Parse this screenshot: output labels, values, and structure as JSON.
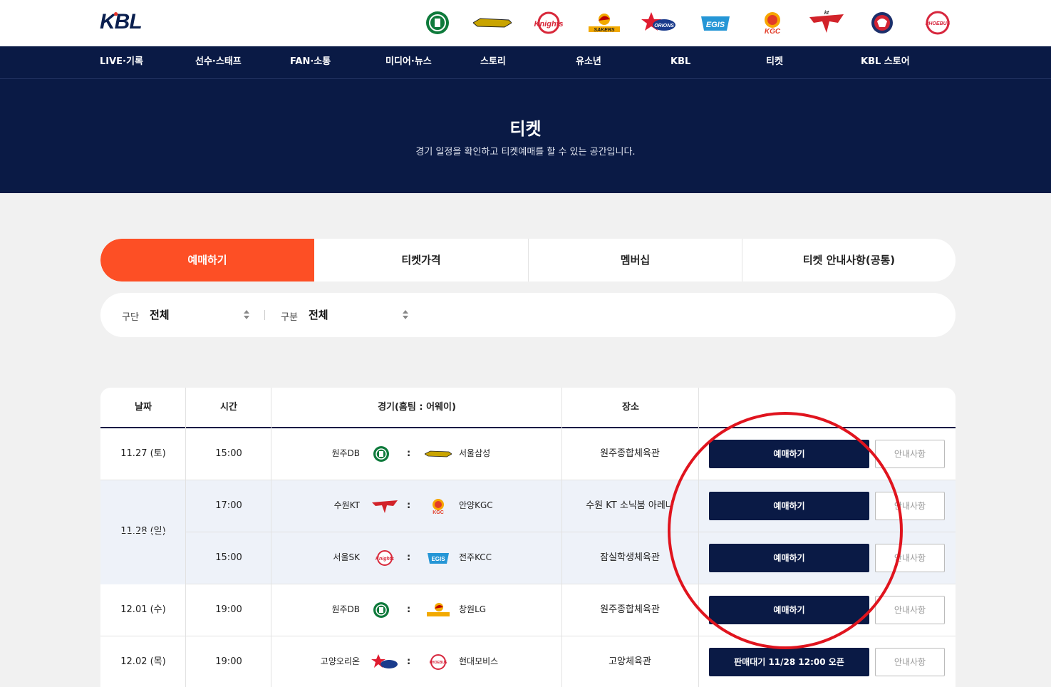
{
  "header": {
    "logo_text": "KBL",
    "team_logos": [
      {
        "name": "db-promy",
        "label": "DB",
        "color": "#0e7a3b"
      },
      {
        "name": "samsung-thunders",
        "label": "thunders",
        "color": "#c9a400"
      },
      {
        "name": "sk-knights",
        "label": "Knights",
        "color": "#d8283a"
      },
      {
        "name": "lg-sakers",
        "label": "SAKERS",
        "color": "#f2a900"
      },
      {
        "name": "orions",
        "label": "ORIONS",
        "color": "#e01b2f"
      },
      {
        "name": "kcc-egis",
        "label": "EGIS",
        "color": "#2596d6"
      },
      {
        "name": "kgc",
        "label": "KGC",
        "color": "#e23b27"
      },
      {
        "name": "kt-sonicboom",
        "label": "kt",
        "color": "#d2232a"
      },
      {
        "name": "elephants",
        "label": "",
        "color": "#1c2f6b"
      },
      {
        "name": "phoebus",
        "label": "PHOEBUS",
        "color": "#d7263d"
      }
    ]
  },
  "nav": {
    "items": [
      "LIVE·기록",
      "선수·스태프",
      "FAN·소통",
      "미디어·뉴스",
      "스토리",
      "유소년",
      "KBL",
      "티켓",
      "KBL 스토어"
    ]
  },
  "hero": {
    "title": "티켓",
    "subtitle": "경기 일정을 확인하고 티켓예매를 할 수 있는 공간입니다."
  },
  "tabs": [
    "예매하기",
    "티켓가격",
    "멤버십",
    "티켓 안내사항(공통)"
  ],
  "filters": {
    "section_label": "구단",
    "section_value": "전체",
    "type_label": "구분",
    "type_value": "전체"
  },
  "table": {
    "headers": [
      "날짜",
      "시간",
      "경기(홈팀 : 어웨이)",
      "장소",
      ""
    ],
    "rows": [
      {
        "date": "11.27 (토)",
        "time": "15:00",
        "home": "원주DB",
        "home_logo": "db-promy",
        "away": "서울삼성",
        "away_logo": "samsung-thunders",
        "venue": "원주종합체육관",
        "buy": "예매하기",
        "info": "안내사항"
      },
      {
        "date": "11.28 (일)",
        "time": "17:00",
        "home": "수원KT",
        "home_logo": "kt-sonicboom",
        "away": "안양KGC",
        "away_logo": "kgc",
        "venue": "수원 KT 소닉붐 아레나",
        "buy": "예매하기",
        "info": "안내사항"
      },
      {
        "date": "",
        "time": "15:00",
        "home": "서울SK",
        "home_logo": "sk-knights",
        "away": "전주KCC",
        "away_logo": "kcc-egis",
        "venue": "잠실학생체육관",
        "buy": "예매하기",
        "info": "안내사항"
      },
      {
        "date": "12.01 (수)",
        "time": "19:00",
        "home": "원주DB",
        "home_logo": "db-promy",
        "away": "창원LG",
        "away_logo": "lg-sakers",
        "venue": "원주종합체육관",
        "buy": "예매하기",
        "info": "안내사항"
      },
      {
        "date": "12.02 (목)",
        "time": "19:00",
        "home": "고양오리온",
        "home_logo": "orions",
        "away": "현대모비스",
        "away_logo": "phoebus",
        "venue": "고양체육관",
        "buy": "판매대기 11/28 12:00 오픈",
        "info": "안내사항"
      }
    ]
  },
  "colors": {
    "navy": "#0a1a45",
    "accent": "#fd4f25",
    "annotation": "#e0141e"
  }
}
